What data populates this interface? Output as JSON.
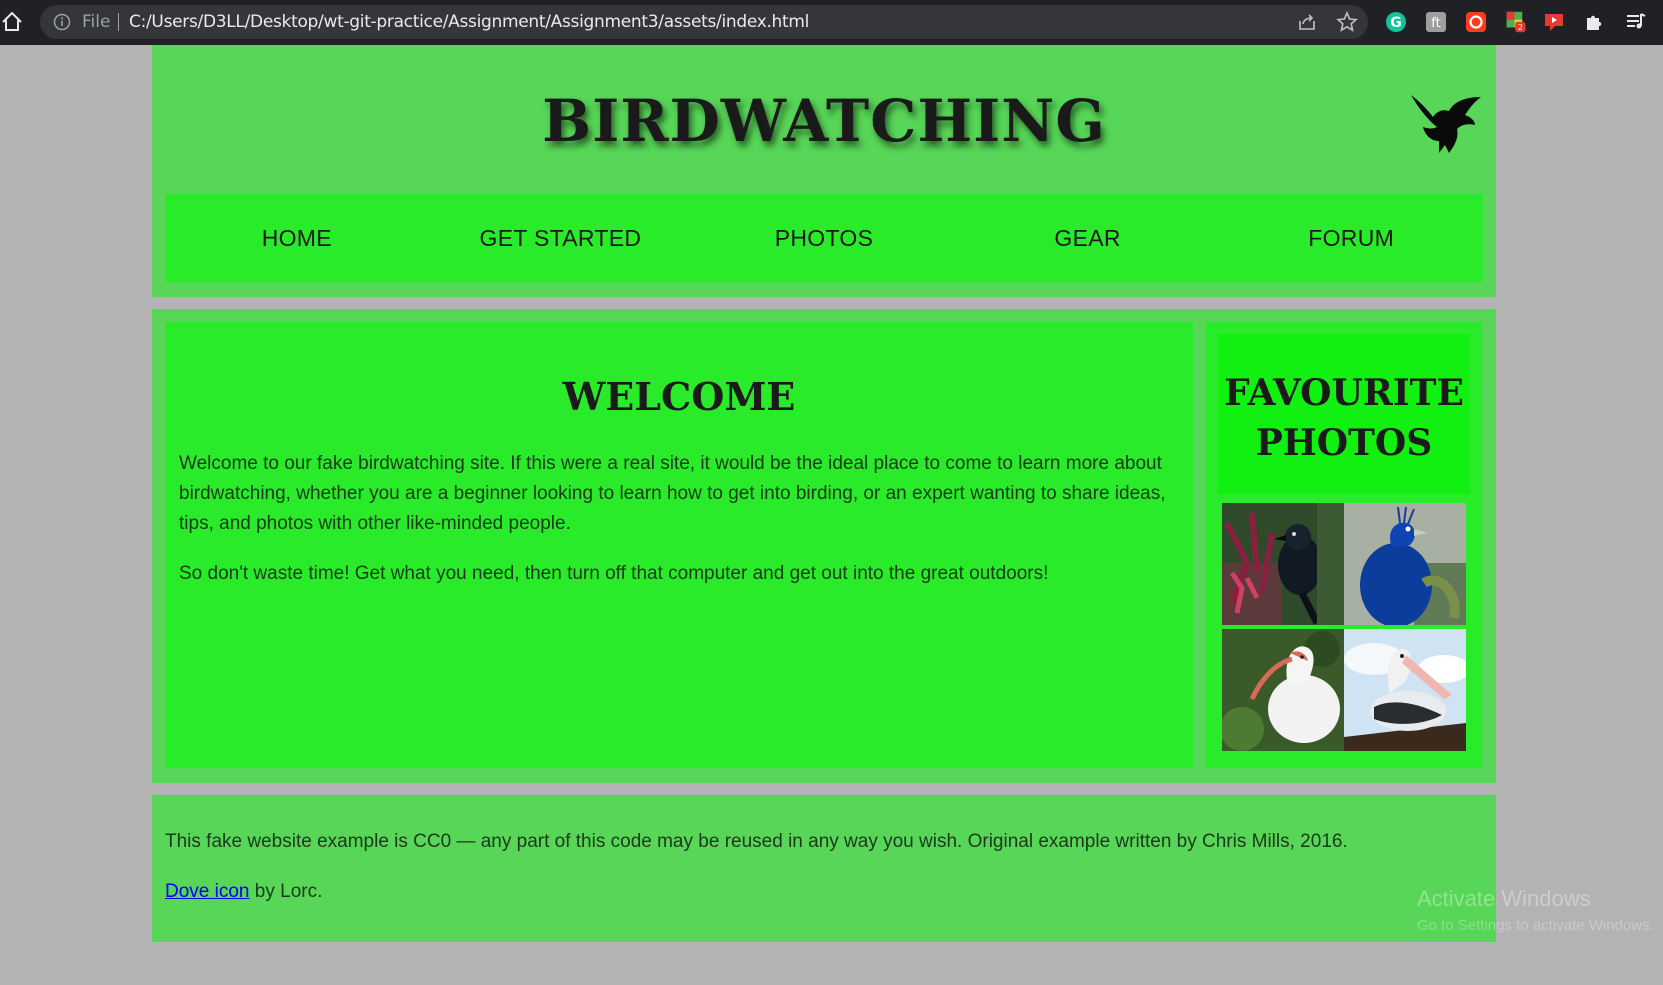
{
  "browser": {
    "file_label": "File",
    "url": "C:/Users/D3LL/Desktop/wt-git-practice/Assignment/Assignment3/assets/index.html",
    "extension_badge": "2"
  },
  "header": {
    "title": "BIRDWATCHING"
  },
  "nav": {
    "items": [
      "HOME",
      "GET STARTED",
      "PHOTOS",
      "GEAR",
      "FORUM"
    ]
  },
  "article": {
    "heading": "WELCOME",
    "paragraphs": [
      "Welcome to our fake birdwatching site. If this were a real site, it would be the ideal place to come to learn more about birdwatching, whether you are a beginner looking to learn how to get into birding, or an expert wanting to share ideas, tips, and photos with other like-minded people.",
      "So don't waste time! Get what you need, then turn off that computer and get out into the great outdoors!"
    ]
  },
  "aside": {
    "heading": "FAVOURITE PHOTOS"
  },
  "footer": {
    "license": "This fake website example is CC0 — any part of this code may be reused in any way you wish. Original example written by Chris Mills, 2016.",
    "credit_link": "Dove icon",
    "credit_suffix": " by Lorc."
  },
  "watermark": {
    "line1": "Activate Windows",
    "line2": "Go to Settings to activate Windows."
  },
  "colors": {
    "outer_panel": "#57d657",
    "inner_panel": "#2aeb2a",
    "page_bg": "#b3b3b3"
  }
}
